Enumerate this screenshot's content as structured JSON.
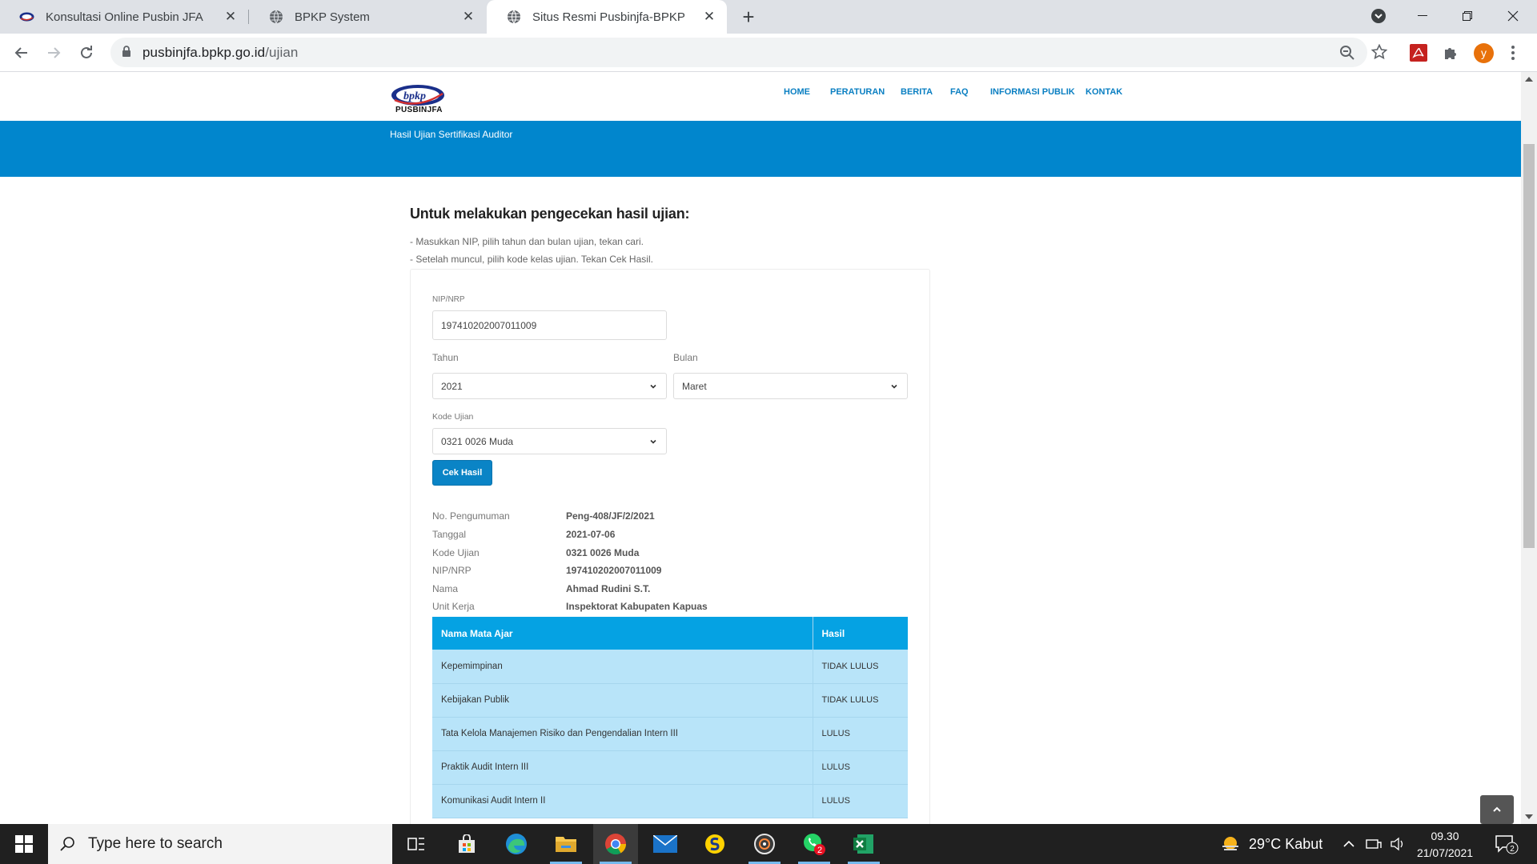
{
  "browser": {
    "tabs": [
      {
        "title": "Konsultasi Online Pusbin JFA",
        "active": false
      },
      {
        "title": "BPKP System",
        "active": false
      },
      {
        "title": "Situs Resmi Pusbinjfa-BPKP",
        "active": true
      }
    ],
    "url_host": "pusbinjfa.bpkp.go.id",
    "url_path": "/ujian",
    "profile_initial": "y"
  },
  "site": {
    "logo_text": "PUSBINJFA",
    "logo_mark": "bpkp",
    "nav": [
      "HOME",
      "PERATURAN",
      "BERITA",
      "FAQ",
      "INFORMASI PUBLIK",
      "KONTAK"
    ],
    "banner_title": "Hasil Ujian Sertifikasi Auditor"
  },
  "content": {
    "title": "Untuk melakukan pengecekan hasil ujian:",
    "instructions": [
      "- Masukkan NIP, pilih tahun dan bulan ujian, tekan cari.",
      "- Setelah muncul, pilih kode kelas ujian. Tekan Cek Hasil."
    ],
    "form": {
      "nip_label": "NIP/NRP",
      "nip_value": "197410202007011009",
      "tahun_label": "Tahun",
      "tahun_value": "2021",
      "bulan_label": "Bulan",
      "bulan_value": "Maret",
      "kode_label": "Kode Ujian",
      "kode_value": "0321 0026 Muda",
      "submit_label": "Cek Hasil"
    },
    "info": [
      {
        "label": "No. Pengumuman",
        "value": "Peng-408/JF/2/2021"
      },
      {
        "label": "Tanggal",
        "value": "2021-07-06"
      },
      {
        "label": "Kode Ujian",
        "value": "0321 0026 Muda"
      },
      {
        "label": "NIP/NRP",
        "value": "197410202007011009"
      },
      {
        "label": "Nama",
        "value": "Ahmad Rudini S.T."
      },
      {
        "label": "Unit Kerja",
        "value": "Inspektorat Kabupaten Kapuas"
      }
    ],
    "table": {
      "headers": [
        "Nama Mata Ajar",
        "Hasil"
      ],
      "rows": [
        [
          "Kepemimpinan",
          "TIDAK LULUS"
        ],
        [
          "Kebijakan Publik",
          "TIDAK LULUS"
        ],
        [
          "Tata Kelola Manajemen Risiko dan Pengendalian Intern III",
          "LULUS"
        ],
        [
          "Praktik Audit Intern III",
          "LULUS"
        ],
        [
          "Komunikasi Audit Intern II",
          "LULUS"
        ]
      ]
    }
  },
  "taskbar": {
    "search_placeholder": "Type here to search",
    "weather": "29°C  Kabut",
    "time": "09.30",
    "date": "21/07/2021",
    "whatsapp_badge": "2",
    "notification_count": "2"
  },
  "colors": {
    "brand_blue": "#0186cd",
    "table_header": "#05a2e3",
    "table_row": "#b8e4f9",
    "button": "#0a84c6"
  }
}
